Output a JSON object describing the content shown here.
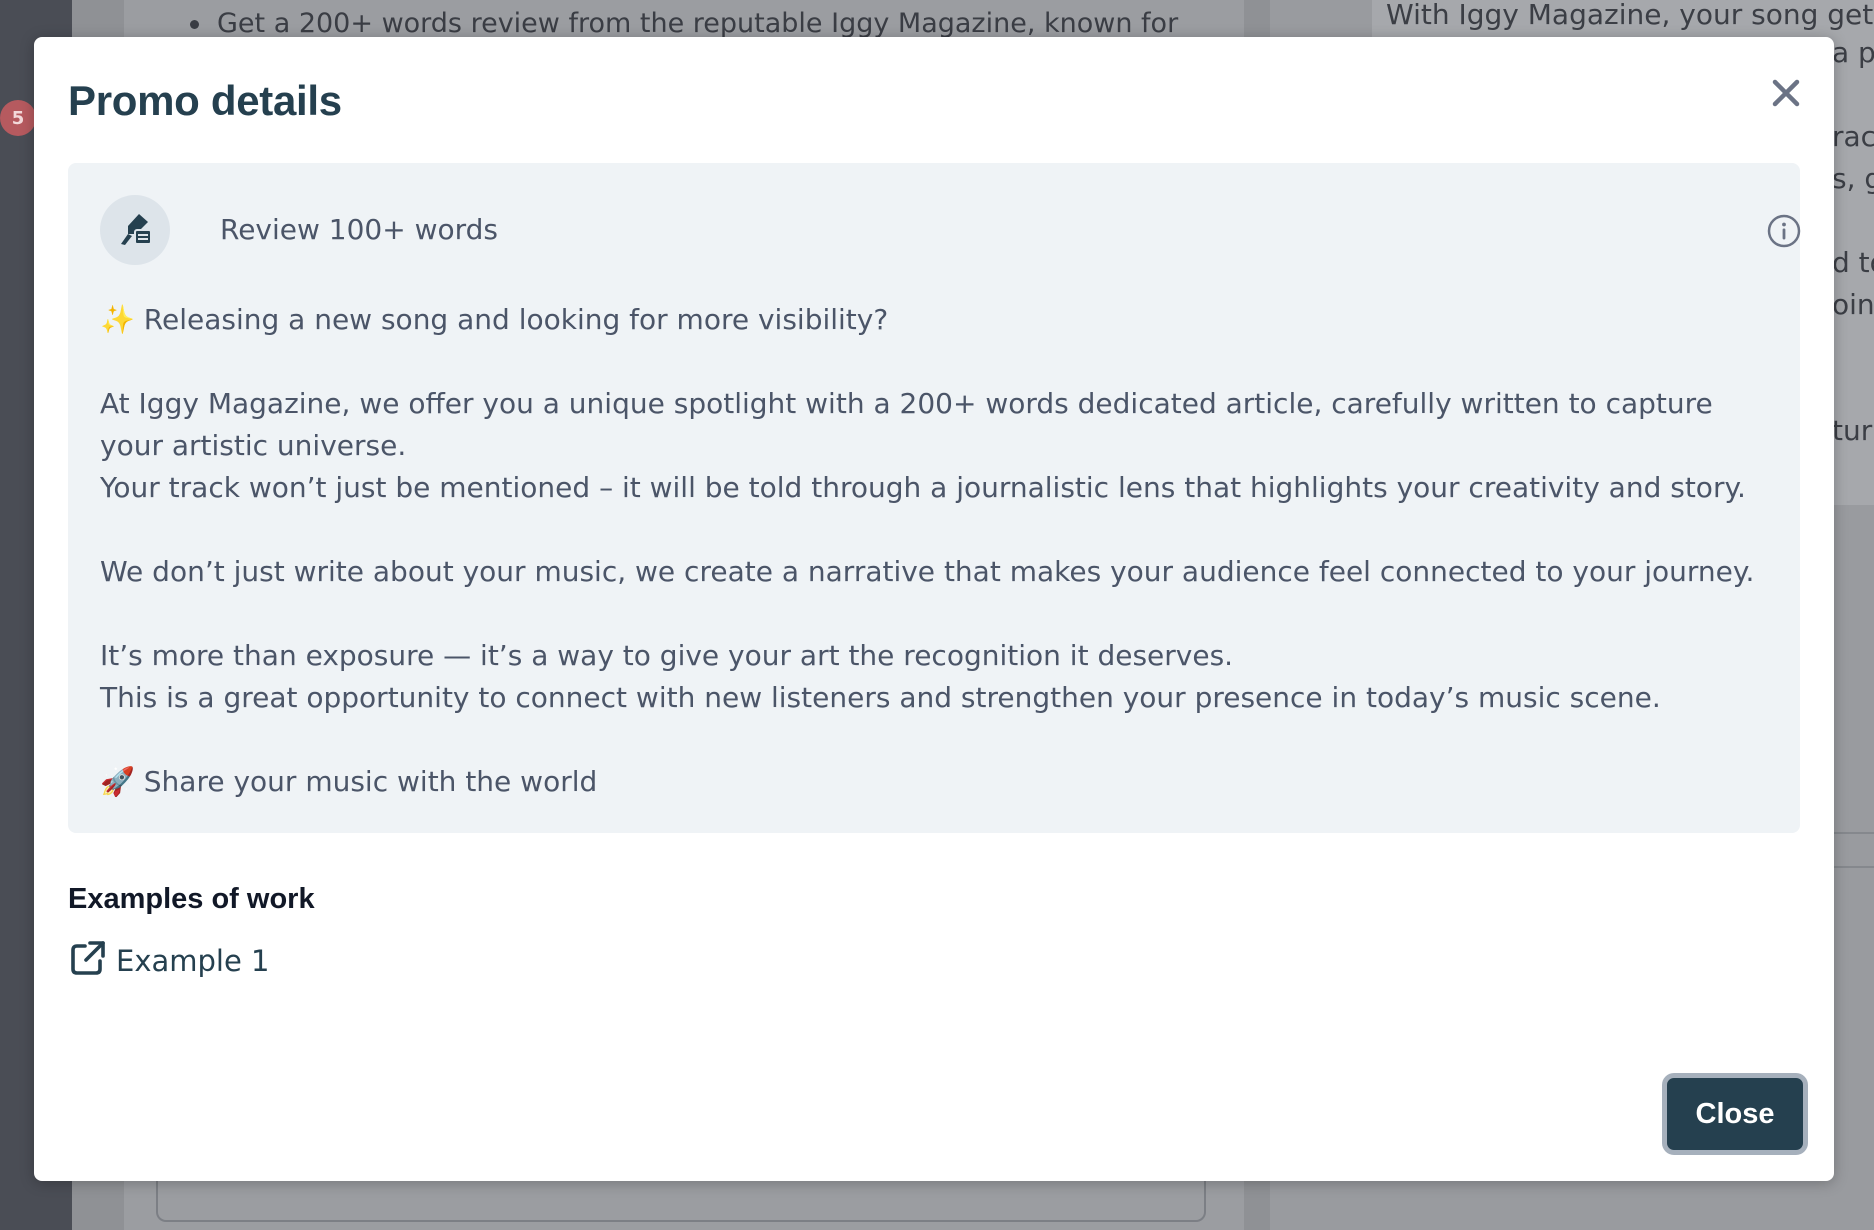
{
  "background": {
    "badge_count": "5",
    "bullet_text": "Get a 200+ words review from the reputable Iggy Magazine, known for",
    "right_text": "With Iggy Magazine, your song gets",
    "right_fragments": [
      "a pr",
      "rac",
      "s, g",
      "d to",
      "oing",
      "tur"
    ]
  },
  "modal": {
    "title": "Promo details",
    "promo": {
      "name": "Review 100+ words",
      "description": [
        "✨ Releasing a new song and looking for more visibility?",
        "At Iggy Magazine, we offer you a unique spotlight with a 200+ words dedicated article, carefully written to capture your artistic universe.",
        "Your track won’t just be mentioned – it will be told through a journalistic lens that highlights your creativity and story.",
        "We don’t just write about your music, we create a narrative that makes your audience feel connected to your journey.",
        "It’s more than exposure — it’s a way to give your art the recognition it deserves.",
        "This is a great opportunity to connect with new listeners and strengthen your presence in today’s music scene.",
        "🚀 Share your music with the world"
      ]
    },
    "examples_heading": "Examples of work",
    "examples": [
      {
        "label": "Example 1"
      }
    ],
    "close_label": "Close"
  },
  "icons": {
    "close": "close-icon",
    "promo": "pen-writing-icon",
    "info": "info-icon",
    "external_link": "external-link-icon"
  },
  "colors": {
    "primary": "#25404f",
    "promo_bg": "#eff3f6",
    "text": "#4b5568",
    "heading": "#111827"
  }
}
